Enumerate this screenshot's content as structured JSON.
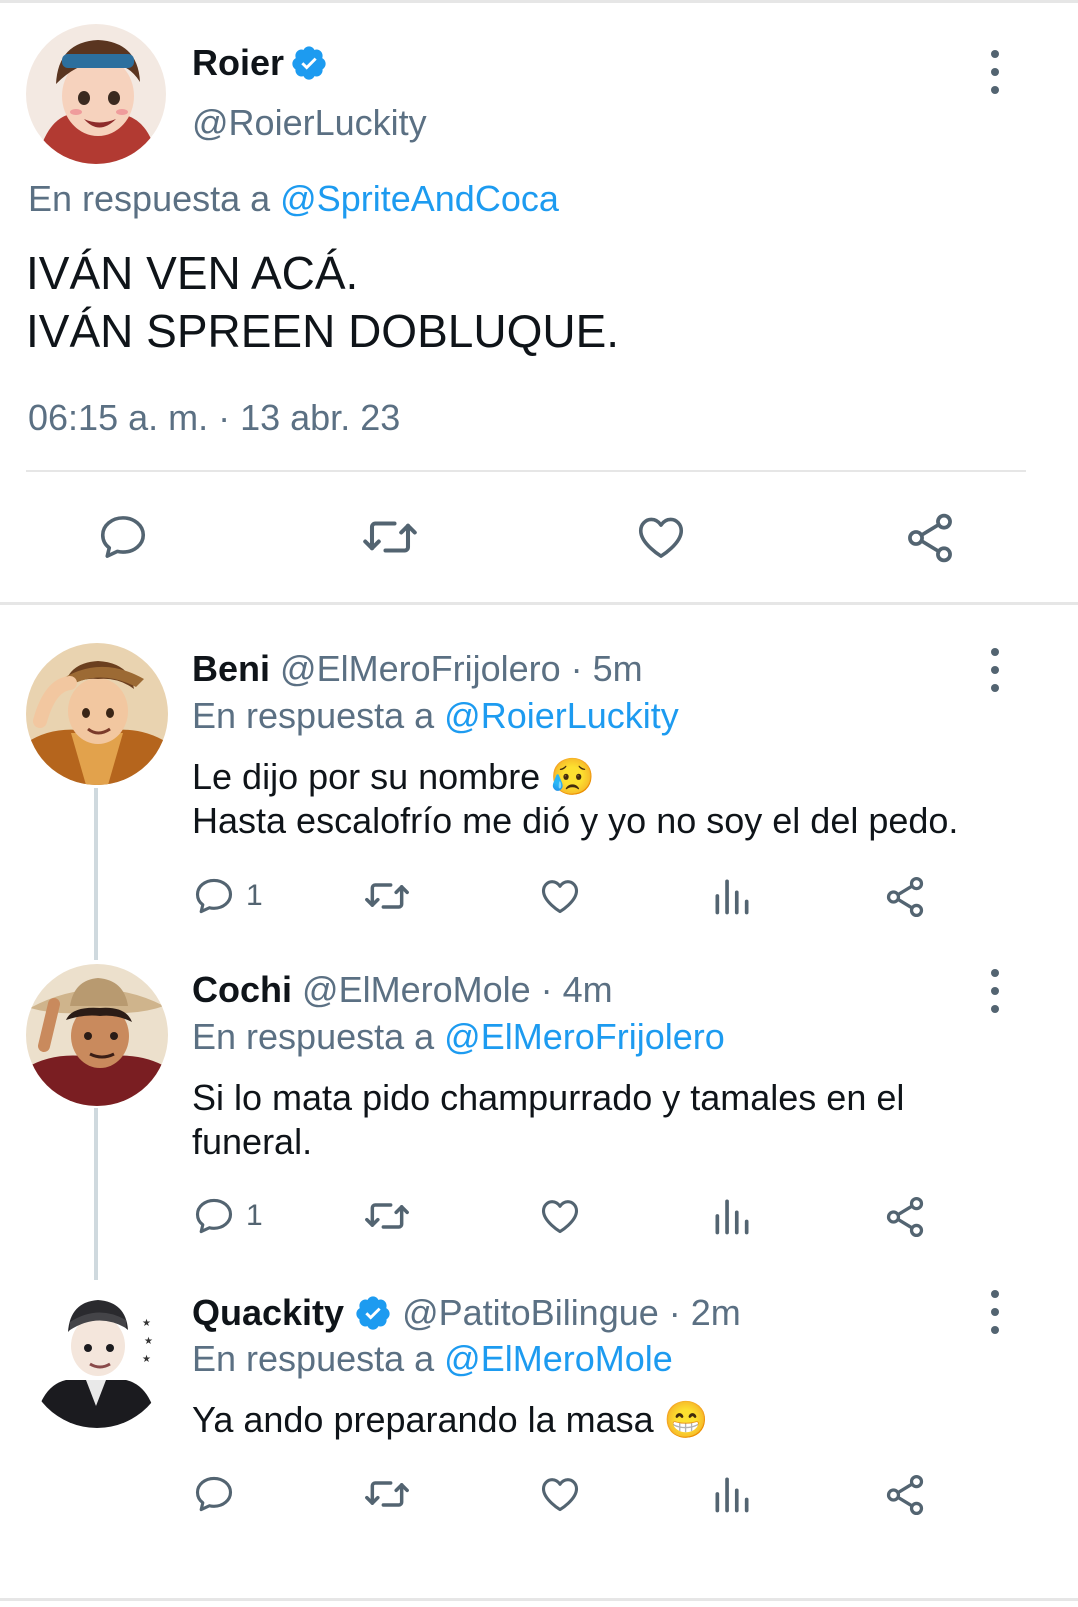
{
  "main_tweet": {
    "name": "Roier",
    "handle": "@RoierLuckity",
    "reply_prefix": "En respuesta a",
    "reply_to": "@SpriteAndCoca",
    "line1": "IVÁN VEN ACÁ.",
    "line2": "IVÁN SPREEN DOBLUQUE.",
    "timestamp": "06:15 a. m. · 13 abr. 23",
    "verified": true
  },
  "replies": [
    {
      "name": "Beni",
      "meta": "@ElMeroFrijolero · 5m",
      "reply_prefix": "En respuesta a",
      "reply_to": "@RoierLuckity",
      "line1": "Le dijo por su nombre",
      "line1_emoji": "😥",
      "line2": "Hasta escalofrío me dió y yo no soy el del pedo.",
      "reply_count": "1"
    },
    {
      "name": "Cochi",
      "meta": "@ElMeroMole · 4m",
      "reply_prefix": "En respuesta a",
      "reply_to": "@ElMeroFrijolero",
      "line1": "Si lo mata pido champurrado y tamales en el",
      "line2": "funeral.",
      "reply_count": "1"
    },
    {
      "name": "Quackity",
      "meta": "@PatitoBilingue · 2m",
      "reply_prefix": "En respuesta a",
      "reply_to": "@ElMeroMole",
      "line1": "Ya ando preparando la masa",
      "line1_emoji": "😁",
      "verified": true
    }
  ],
  "colors": {
    "accent": "#1d9bf0",
    "text": "#0f1419",
    "secondary": "#5b7083",
    "icon": "#536471",
    "divider": "#e6e6e6"
  },
  "icons": [
    "verified-badge-icon",
    "more-options-icon",
    "reply-icon",
    "retweet-icon",
    "like-icon",
    "share-icon",
    "views-icon"
  ]
}
